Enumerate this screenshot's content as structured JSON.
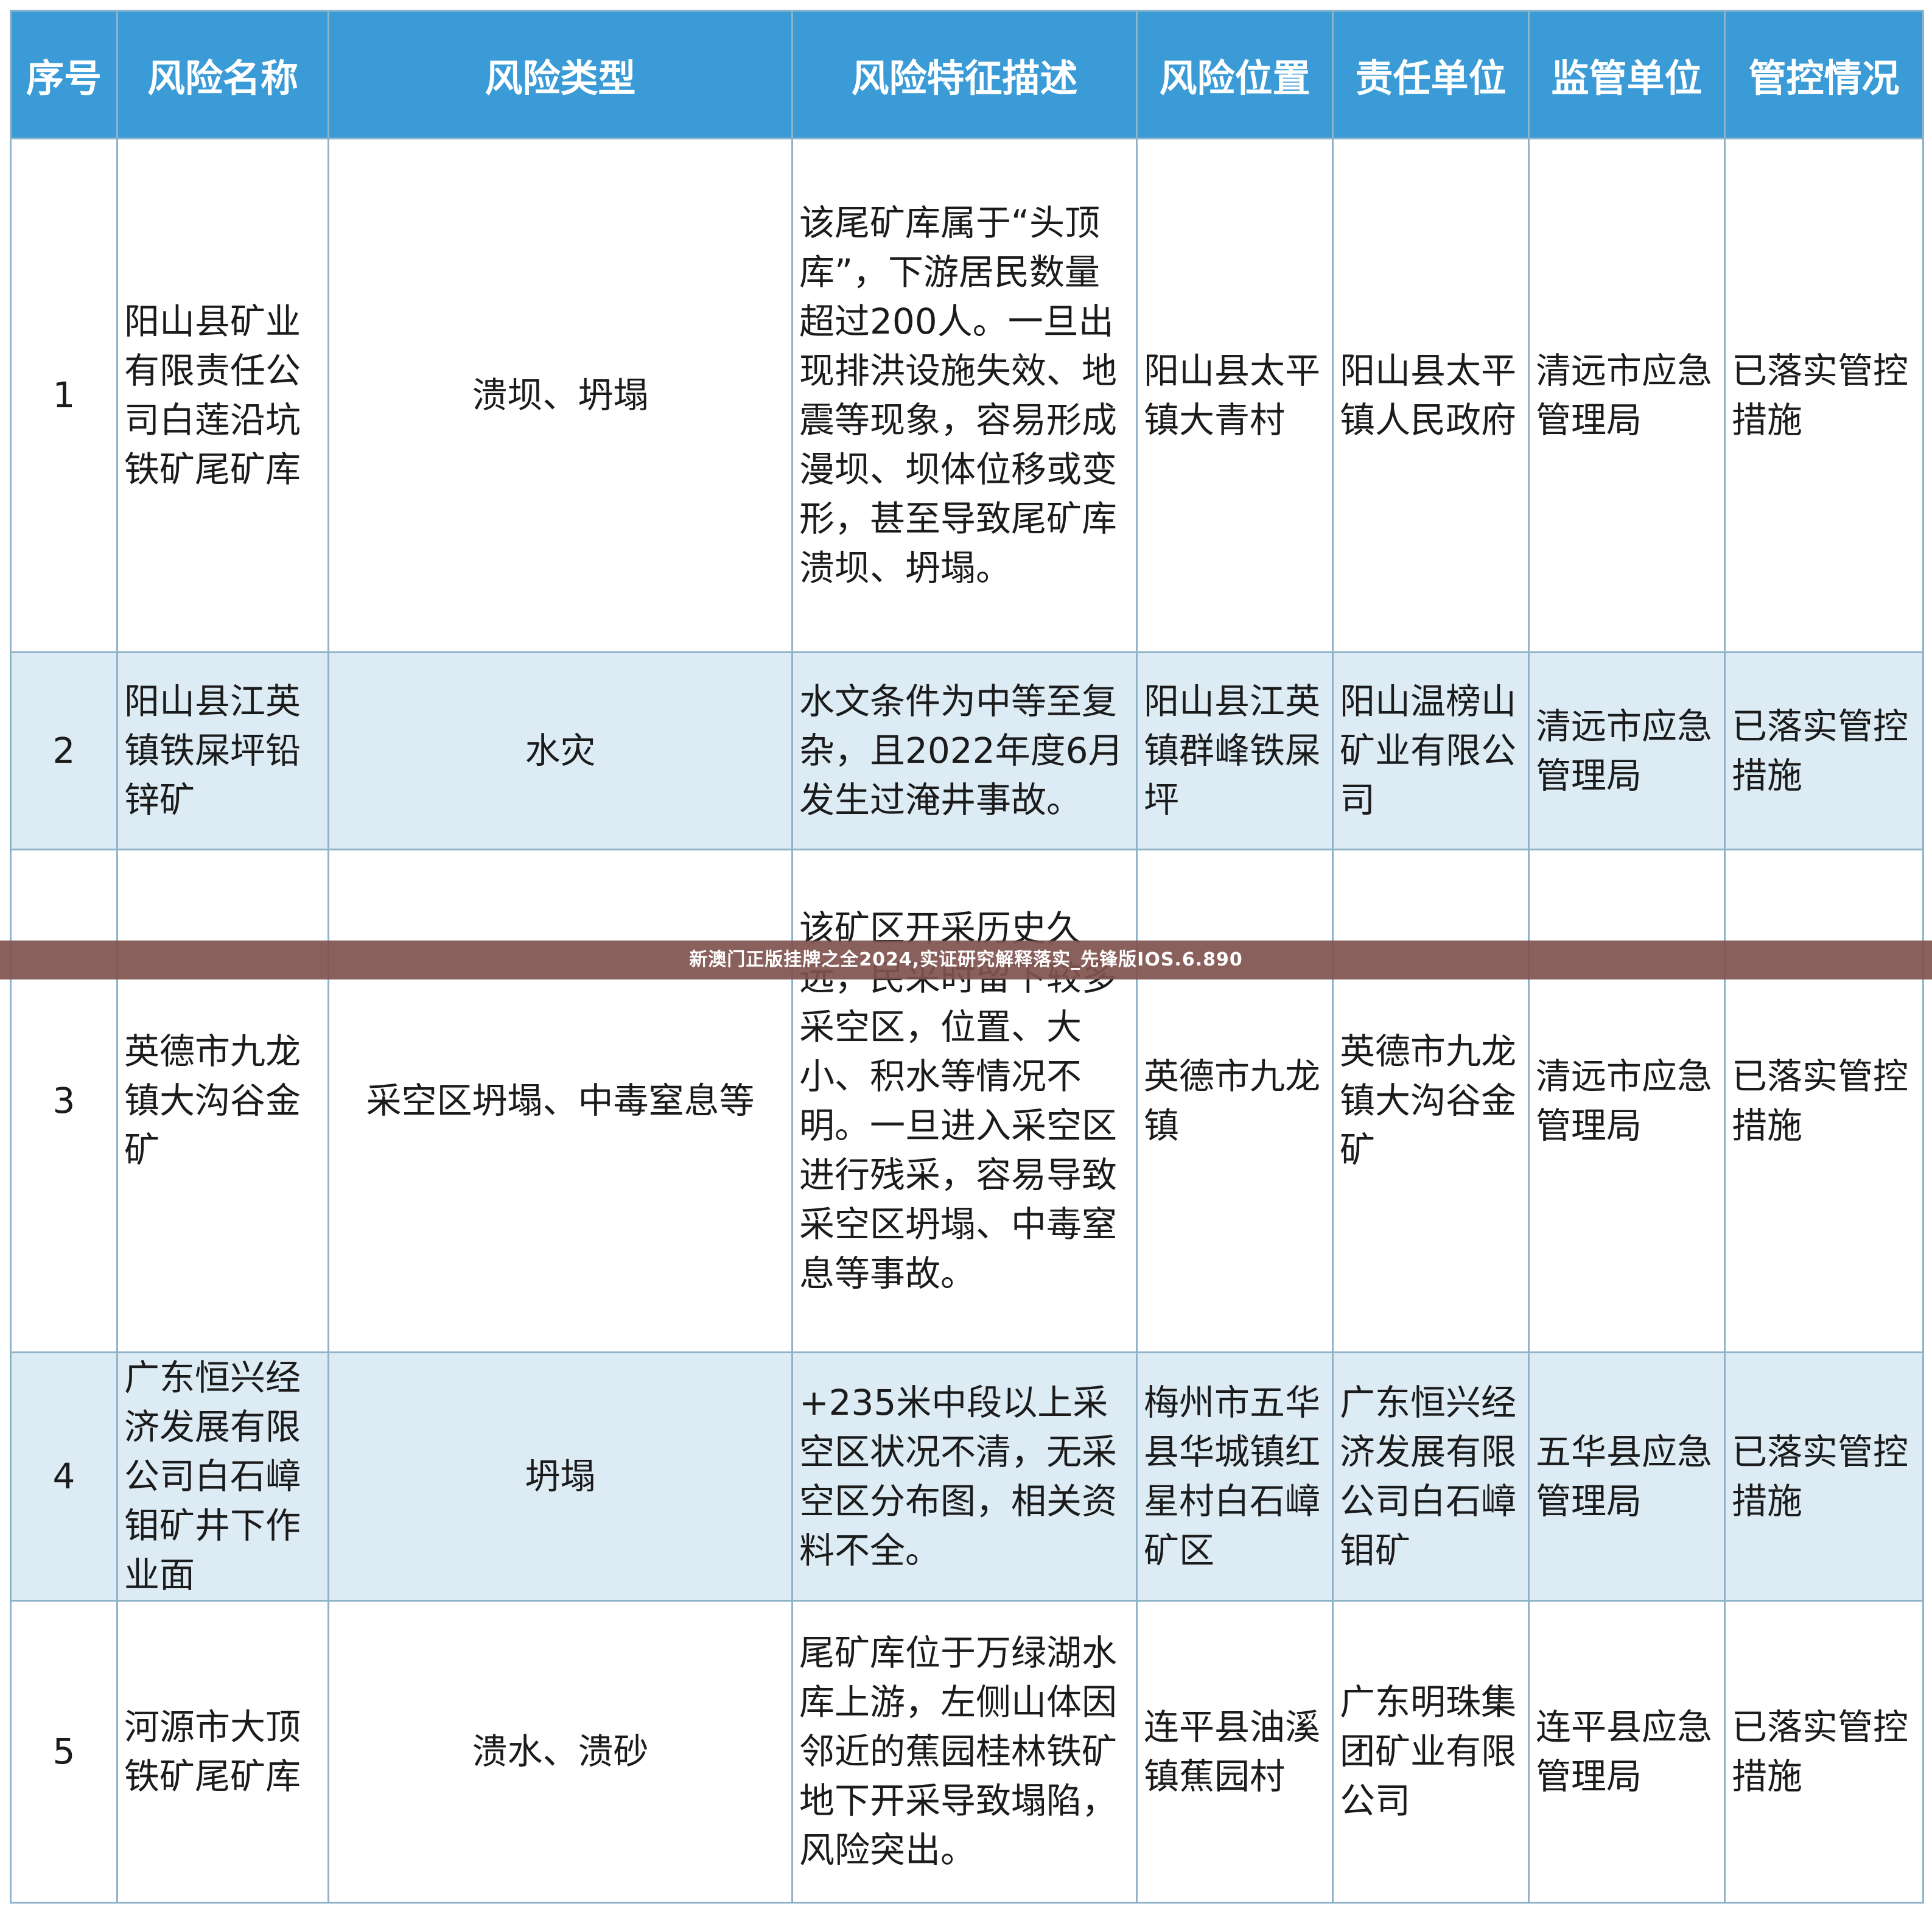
{
  "table": {
    "headers": [
      "序号",
      "风险名称",
      "风险类型",
      "风险特征描述",
      "风险位置",
      "责任单位",
      "监管单位",
      "管控情况"
    ],
    "rows": [
      {
        "no": "1",
        "name": "阳山县矿业有限责任公司白莲沿坑铁矿尾矿库",
        "type": "溃坝、坍塌",
        "desc": "该尾矿库属于“头顶库”，下游居民数量超过200人。一旦出现排洪设施失效、地震等现象，容易形成漫坝、坝体位移或变形，甚至导致尾矿库溃坝、坍塌。",
        "location": "阳山县太平镇大青村",
        "responsible": "阳山县太平镇人民政府",
        "supervisor": "清远市应急管理局",
        "control": "已落实管控措施"
      },
      {
        "no": "2",
        "name": "阳山县江英镇铁屎坪铅锌矿",
        "type": "水灾",
        "desc": "水文条件为中等至复杂，且2022年度6月发生过淹井事故。",
        "location": "阳山县江英镇群峰铁屎坪",
        "responsible": "阳山温榜山矿业有限公司",
        "supervisor": "清远市应急管理局",
        "control": "已落实管控措施"
      },
      {
        "no": "3",
        "name": "英德市九龙镇大沟谷金矿",
        "type": "采空区坍塌、中毒窒息等",
        "desc": "该矿区开采历史久远，民采时留下较多采空区，位置、大小、积水等情况不明。一旦进入采空区进行残采，容易导致采空区坍塌、中毒窒息等事故。",
        "location": "英德市九龙镇",
        "responsible": "英德市九龙镇大沟谷金矿",
        "supervisor": "清远市应急管理局",
        "control": "已落实管控措施"
      },
      {
        "no": "4",
        "name": "广东恒兴经济发展有限公司白石嶂钼矿井下作业面",
        "type": "坍塌",
        "desc": "+235米中段以上采空区状况不清，无采空区分布图，相关资料不全。",
        "location": "梅州市五华县华城镇红星村白石嶂矿区",
        "responsible": "广东恒兴经济发展有限公司白石嶂钼矿",
        "supervisor": "五华县应急管理局",
        "control": "已落实管控措施"
      },
      {
        "no": "5",
        "name": "河源市大顶铁矿尾矿库",
        "type": "溃水、溃砂",
        "desc": "尾矿库位于万绿湖水库上游，左侧山体因邻近的蕉园桂林铁矿地下开采导致塌陷，风险突出。",
        "location": "连平县油溪镇蕉园村",
        "responsible": "广东明珠集团矿业有限公司",
        "supervisor": "连平县应急管理局",
        "control": "已落实管控措施"
      }
    ]
  },
  "watermark": "新澳门正版挂牌之全2024,实证研究解释落实_先锋版IOS.6.890",
  "colors": {
    "header_bg": "#3a9bd7",
    "alt_row_bg": "#dcebf4",
    "border": "#8fb3c9",
    "watermark_bg": "#80524e"
  }
}
